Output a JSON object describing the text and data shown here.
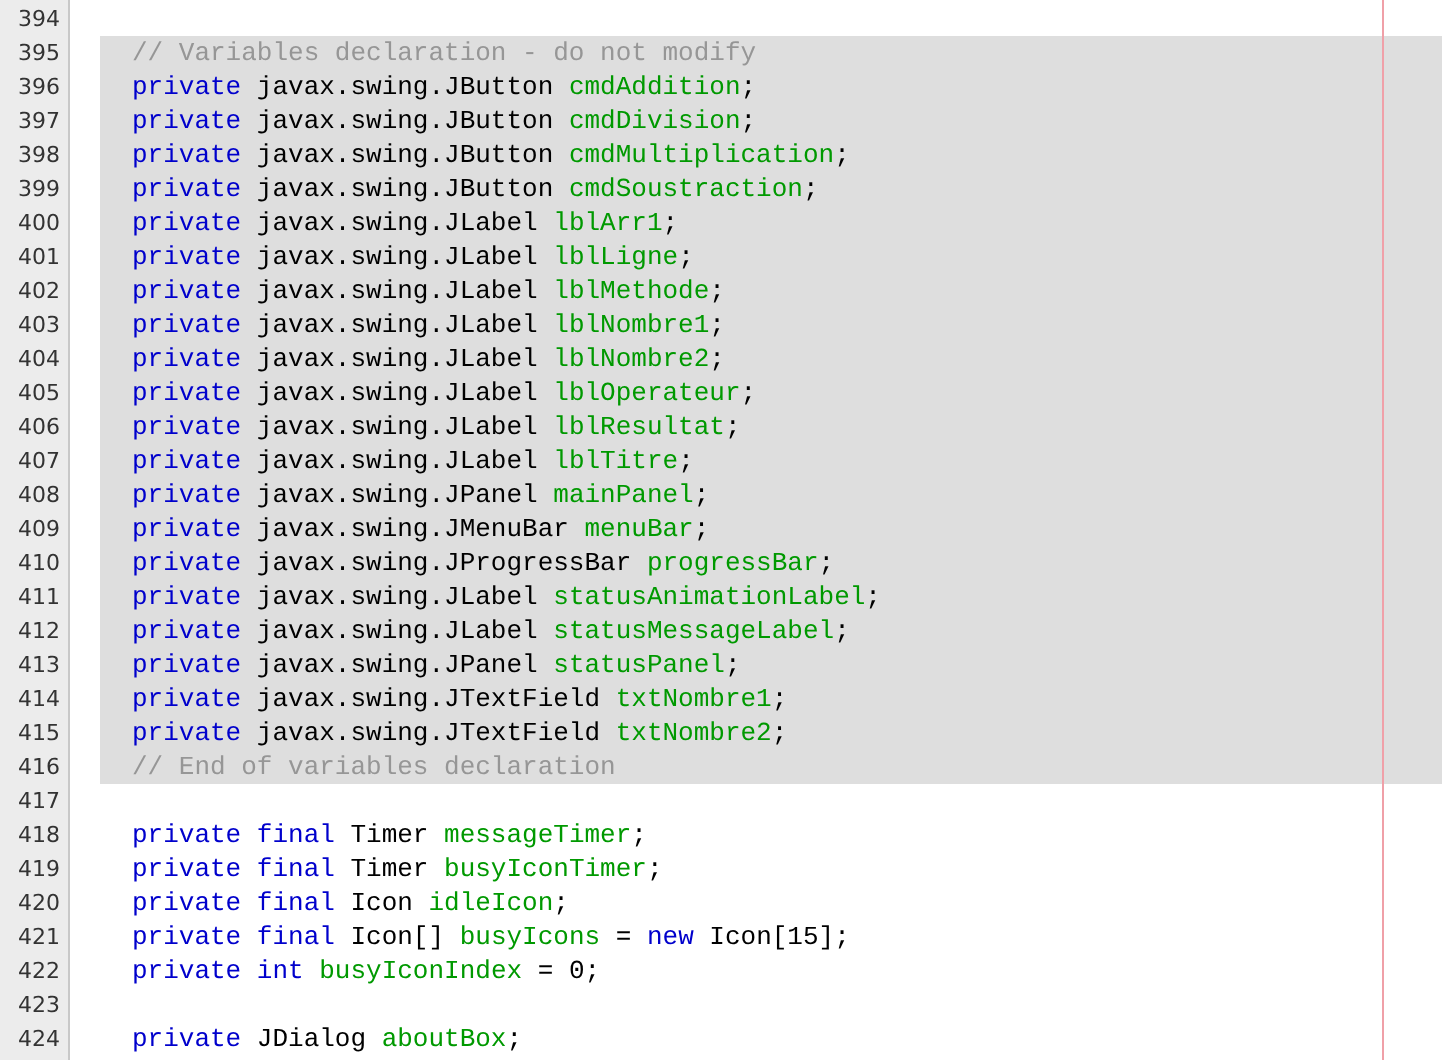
{
  "editor": {
    "lines": [
      {
        "number": "394",
        "guarded": false
      },
      {
        "number": "395",
        "guarded": true,
        "tokens": [
          {
            "kind": "comment",
            "text": "// Variables declaration - do not modify"
          }
        ]
      },
      {
        "number": "396",
        "guarded": true,
        "tokens": [
          {
            "kind": "keyword",
            "text": "private"
          },
          {
            "kind": "plain",
            "text": " javax.swing.JButton "
          },
          {
            "kind": "field",
            "text": "cmdAddition"
          },
          {
            "kind": "plain",
            "text": ";"
          }
        ]
      },
      {
        "number": "397",
        "guarded": true,
        "tokens": [
          {
            "kind": "keyword",
            "text": "private"
          },
          {
            "kind": "plain",
            "text": " javax.swing.JButton "
          },
          {
            "kind": "field",
            "text": "cmdDivision"
          },
          {
            "kind": "plain",
            "text": ";"
          }
        ]
      },
      {
        "number": "398",
        "guarded": true,
        "tokens": [
          {
            "kind": "keyword",
            "text": "private"
          },
          {
            "kind": "plain",
            "text": " javax.swing.JButton "
          },
          {
            "kind": "field",
            "text": "cmdMultiplication"
          },
          {
            "kind": "plain",
            "text": ";"
          }
        ]
      },
      {
        "number": "399",
        "guarded": true,
        "tokens": [
          {
            "kind": "keyword",
            "text": "private"
          },
          {
            "kind": "plain",
            "text": " javax.swing.JButton "
          },
          {
            "kind": "field",
            "text": "cmdSoustraction"
          },
          {
            "kind": "plain",
            "text": ";"
          }
        ]
      },
      {
        "number": "400",
        "guarded": true,
        "tokens": [
          {
            "kind": "keyword",
            "text": "private"
          },
          {
            "kind": "plain",
            "text": " javax.swing.JLabel "
          },
          {
            "kind": "field",
            "text": "lblArr1"
          },
          {
            "kind": "plain",
            "text": ";"
          }
        ]
      },
      {
        "number": "401",
        "guarded": true,
        "tokens": [
          {
            "kind": "keyword",
            "text": "private"
          },
          {
            "kind": "plain",
            "text": " javax.swing.JLabel "
          },
          {
            "kind": "field",
            "text": "lblLigne"
          },
          {
            "kind": "plain",
            "text": ";"
          }
        ]
      },
      {
        "number": "402",
        "guarded": true,
        "tokens": [
          {
            "kind": "keyword",
            "text": "private"
          },
          {
            "kind": "plain",
            "text": " javax.swing.JLabel "
          },
          {
            "kind": "field",
            "text": "lblMethode"
          },
          {
            "kind": "plain",
            "text": ";"
          }
        ]
      },
      {
        "number": "403",
        "guarded": true,
        "tokens": [
          {
            "kind": "keyword",
            "text": "private"
          },
          {
            "kind": "plain",
            "text": " javax.swing.JLabel "
          },
          {
            "kind": "field",
            "text": "lblNombre1"
          },
          {
            "kind": "plain",
            "text": ";"
          }
        ]
      },
      {
        "number": "404",
        "guarded": true,
        "tokens": [
          {
            "kind": "keyword",
            "text": "private"
          },
          {
            "kind": "plain",
            "text": " javax.swing.JLabel "
          },
          {
            "kind": "field",
            "text": "lblNombre2"
          },
          {
            "kind": "plain",
            "text": ";"
          }
        ]
      },
      {
        "number": "405",
        "guarded": true,
        "tokens": [
          {
            "kind": "keyword",
            "text": "private"
          },
          {
            "kind": "plain",
            "text": " javax.swing.JLabel "
          },
          {
            "kind": "field",
            "text": "lblOperateur"
          },
          {
            "kind": "plain",
            "text": ";"
          }
        ]
      },
      {
        "number": "406",
        "guarded": true,
        "tokens": [
          {
            "kind": "keyword",
            "text": "private"
          },
          {
            "kind": "plain",
            "text": " javax.swing.JLabel "
          },
          {
            "kind": "field",
            "text": "lblResultat"
          },
          {
            "kind": "plain",
            "text": ";"
          }
        ]
      },
      {
        "number": "407",
        "guarded": true,
        "tokens": [
          {
            "kind": "keyword",
            "text": "private"
          },
          {
            "kind": "plain",
            "text": " javax.swing.JLabel "
          },
          {
            "kind": "field",
            "text": "lblTitre"
          },
          {
            "kind": "plain",
            "text": ";"
          }
        ]
      },
      {
        "number": "408",
        "guarded": true,
        "tokens": [
          {
            "kind": "keyword",
            "text": "private"
          },
          {
            "kind": "plain",
            "text": " javax.swing.JPanel "
          },
          {
            "kind": "field",
            "text": "mainPanel"
          },
          {
            "kind": "plain",
            "text": ";"
          }
        ]
      },
      {
        "number": "409",
        "guarded": true,
        "tokens": [
          {
            "kind": "keyword",
            "text": "private"
          },
          {
            "kind": "plain",
            "text": " javax.swing.JMenuBar "
          },
          {
            "kind": "field",
            "text": "menuBar"
          },
          {
            "kind": "plain",
            "text": ";"
          }
        ]
      },
      {
        "number": "410",
        "guarded": true,
        "tokens": [
          {
            "kind": "keyword",
            "text": "private"
          },
          {
            "kind": "plain",
            "text": " javax.swing.JProgressBar "
          },
          {
            "kind": "field",
            "text": "progressBar"
          },
          {
            "kind": "plain",
            "text": ";"
          }
        ]
      },
      {
        "number": "411",
        "guarded": true,
        "tokens": [
          {
            "kind": "keyword",
            "text": "private"
          },
          {
            "kind": "plain",
            "text": " javax.swing.JLabel "
          },
          {
            "kind": "field",
            "text": "statusAnimationLabel"
          },
          {
            "kind": "plain",
            "text": ";"
          }
        ]
      },
      {
        "number": "412",
        "guarded": true,
        "tokens": [
          {
            "kind": "keyword",
            "text": "private"
          },
          {
            "kind": "plain",
            "text": " javax.swing.JLabel "
          },
          {
            "kind": "field",
            "text": "statusMessageLabel"
          },
          {
            "kind": "plain",
            "text": ";"
          }
        ]
      },
      {
        "number": "413",
        "guarded": true,
        "tokens": [
          {
            "kind": "keyword",
            "text": "private"
          },
          {
            "kind": "plain",
            "text": " javax.swing.JPanel "
          },
          {
            "kind": "field",
            "text": "statusPanel"
          },
          {
            "kind": "plain",
            "text": ";"
          }
        ]
      },
      {
        "number": "414",
        "guarded": true,
        "tokens": [
          {
            "kind": "keyword",
            "text": "private"
          },
          {
            "kind": "plain",
            "text": " javax.swing.JTextField "
          },
          {
            "kind": "field",
            "text": "txtNombre1"
          },
          {
            "kind": "plain",
            "text": ";"
          }
        ]
      },
      {
        "number": "415",
        "guarded": true,
        "tokens": [
          {
            "kind": "keyword",
            "text": "private"
          },
          {
            "kind": "plain",
            "text": " javax.swing.JTextField "
          },
          {
            "kind": "field",
            "text": "txtNombre2"
          },
          {
            "kind": "plain",
            "text": ";"
          }
        ]
      },
      {
        "number": "416",
        "guarded": true,
        "tokens": [
          {
            "kind": "comment",
            "text": "// End of variables declaration"
          }
        ]
      },
      {
        "number": "417",
        "guarded": false
      },
      {
        "number": "418",
        "guarded": false,
        "tokens": [
          {
            "kind": "keyword",
            "text": "private final"
          },
          {
            "kind": "plain",
            "text": " Timer "
          },
          {
            "kind": "field",
            "text": "messageTimer"
          },
          {
            "kind": "plain",
            "text": ";"
          }
        ]
      },
      {
        "number": "419",
        "guarded": false,
        "tokens": [
          {
            "kind": "keyword",
            "text": "private final"
          },
          {
            "kind": "plain",
            "text": " Timer "
          },
          {
            "kind": "field",
            "text": "busyIconTimer"
          },
          {
            "kind": "plain",
            "text": ";"
          }
        ]
      },
      {
        "number": "420",
        "guarded": false,
        "tokens": [
          {
            "kind": "keyword",
            "text": "private final"
          },
          {
            "kind": "plain",
            "text": " Icon "
          },
          {
            "kind": "field",
            "text": "idleIcon"
          },
          {
            "kind": "plain",
            "text": ";"
          }
        ]
      },
      {
        "number": "421",
        "guarded": false,
        "tokens": [
          {
            "kind": "keyword",
            "text": "private final"
          },
          {
            "kind": "plain",
            "text": " Icon[] "
          },
          {
            "kind": "field",
            "text": "busyIcons"
          },
          {
            "kind": "plain",
            "text": " = "
          },
          {
            "kind": "keyword",
            "text": "new"
          },
          {
            "kind": "plain",
            "text": " Icon[15];"
          }
        ]
      },
      {
        "number": "422",
        "guarded": false,
        "tokens": [
          {
            "kind": "keyword",
            "text": "private int "
          },
          {
            "kind": "field",
            "text": "busyIconIndex"
          },
          {
            "kind": "plain",
            "text": " = 0;"
          }
        ]
      },
      {
        "number": "423",
        "guarded": false
      },
      {
        "number": "424",
        "guarded": false,
        "tokens": [
          {
            "kind": "keyword",
            "text": "private"
          },
          {
            "kind": "plain",
            "text": " JDialog "
          },
          {
            "kind": "field",
            "text": "aboutBox"
          },
          {
            "kind": "plain",
            "text": ";"
          }
        ]
      }
    ]
  }
}
